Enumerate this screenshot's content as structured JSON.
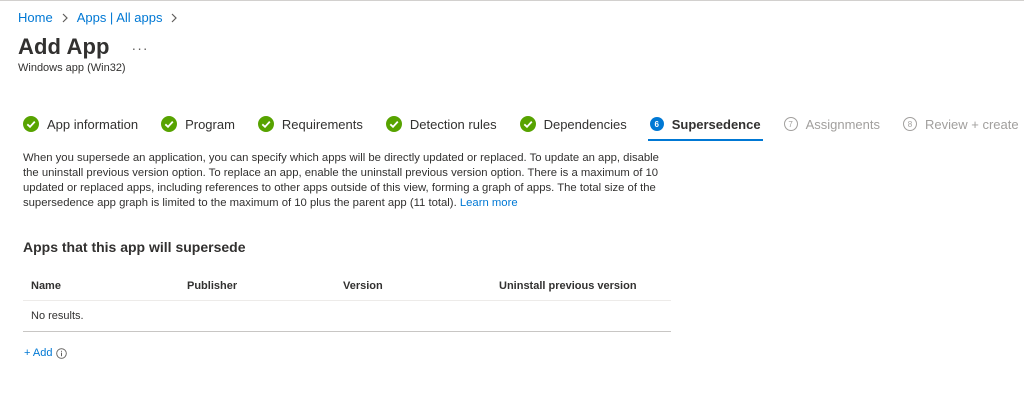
{
  "breadcrumb": {
    "home": "Home",
    "apps": "Apps | All apps"
  },
  "header": {
    "title": "Add App",
    "more": "···",
    "subtitle": "Windows app (Win32)"
  },
  "steps": [
    {
      "label": "App information",
      "state": "done"
    },
    {
      "label": "Program",
      "state": "done"
    },
    {
      "label": "Requirements",
      "state": "done"
    },
    {
      "label": "Detection rules",
      "state": "done"
    },
    {
      "label": "Dependencies",
      "state": "done"
    },
    {
      "label": "Supersedence",
      "state": "current",
      "number": "6"
    },
    {
      "label": "Assignments",
      "state": "future",
      "number": "7"
    },
    {
      "label": "Review + create",
      "state": "future",
      "number": "8"
    }
  ],
  "description": {
    "text": "When you supersede an application, you can specify which apps will be directly updated or replaced. To update an app, disable the uninstall previous version option. To replace an app, enable the uninstall previous version option. There is a maximum of 10 updated or replaced apps, including references to other apps outside of this view, forming a graph of apps. The total size of the supersedence app graph is limited to the maximum of 10 plus the parent app (11 total).",
    "link": "Learn more"
  },
  "section": {
    "title": "Apps that this app will supersede",
    "columns": {
      "name": "Name",
      "publisher": "Publisher",
      "version": "Version",
      "uninstall": "Uninstall previous version"
    },
    "empty": "No results."
  },
  "add": {
    "label": "+ Add"
  },
  "colors": {
    "accent": "#0078d4",
    "success": "#57a300",
    "muted": "#a19f9d"
  }
}
